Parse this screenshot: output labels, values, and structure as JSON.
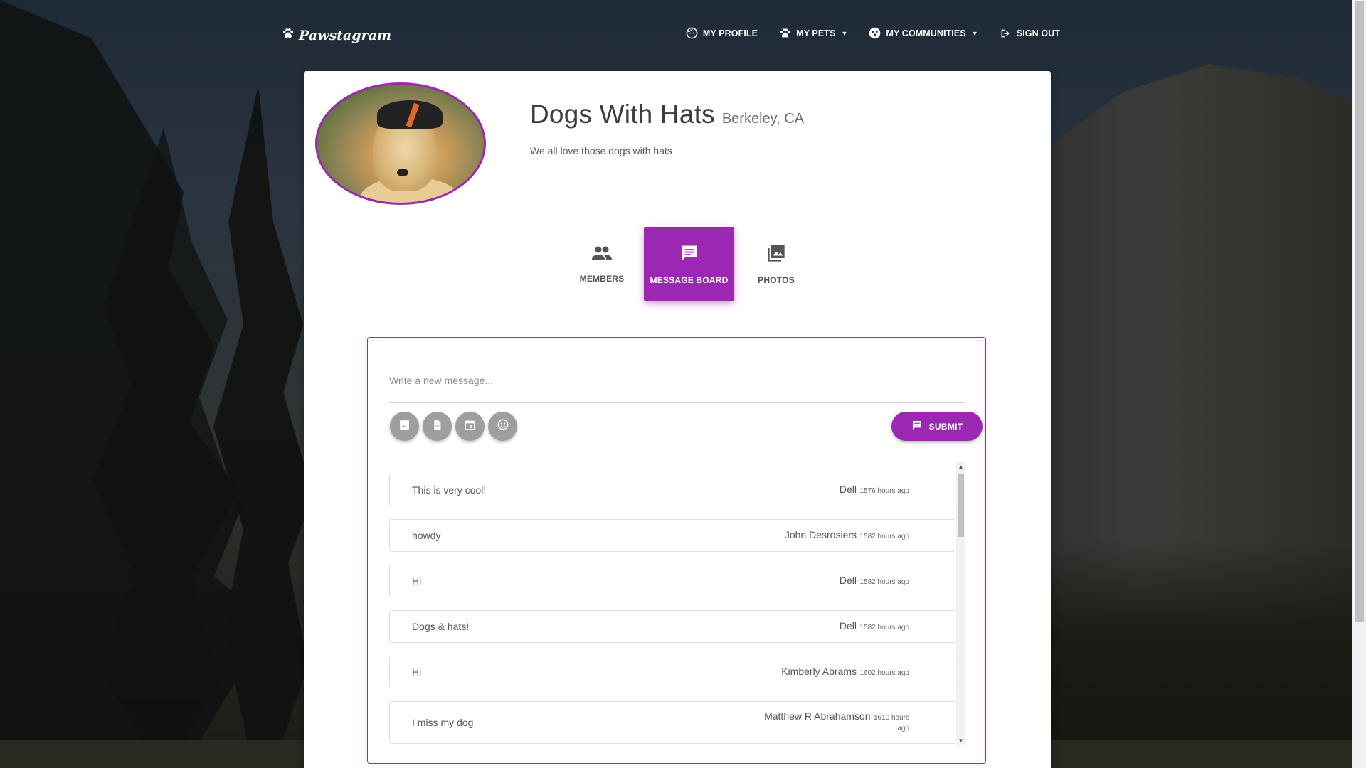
{
  "nav": {
    "brand": "Pawstagram",
    "items": [
      {
        "label": "MY PROFILE"
      },
      {
        "label": "MY PETS"
      },
      {
        "label": "MY COMMUNITIES"
      },
      {
        "label": "SIGN OUT"
      }
    ]
  },
  "community": {
    "name": "Dogs With Hats",
    "location": "Berkeley, CA",
    "description": "We all love those dogs with hats"
  },
  "tabs": [
    {
      "label": "MEMBERS",
      "active": false
    },
    {
      "label": "MESSAGE BOARD",
      "active": true
    },
    {
      "label": "PHOTOS",
      "active": false
    }
  ],
  "board": {
    "placeholder": "Write a new message...",
    "submit_label": "SUBMIT",
    "messages": [
      {
        "text": "This is very cool!",
        "author": "Dell",
        "time": "1576 hours ago"
      },
      {
        "text": "howdy",
        "author": "John Desrosiers",
        "time": "1582 hours ago"
      },
      {
        "text": "Hi",
        "author": "Dell",
        "time": "1582 hours ago"
      },
      {
        "text": "Dogs & hats!",
        "author": "Dell",
        "time": "1582 hours ago"
      },
      {
        "text": "Hi",
        "author": "Kimberly Abrams",
        "time": "1602 hours ago"
      },
      {
        "text": "I miss my dog",
        "author": "Matthew R Abrahamson",
        "time": "1610 hours ago"
      }
    ]
  },
  "colors": {
    "accent": "#9c27b0",
    "tool_button": "#9e9e9e"
  }
}
